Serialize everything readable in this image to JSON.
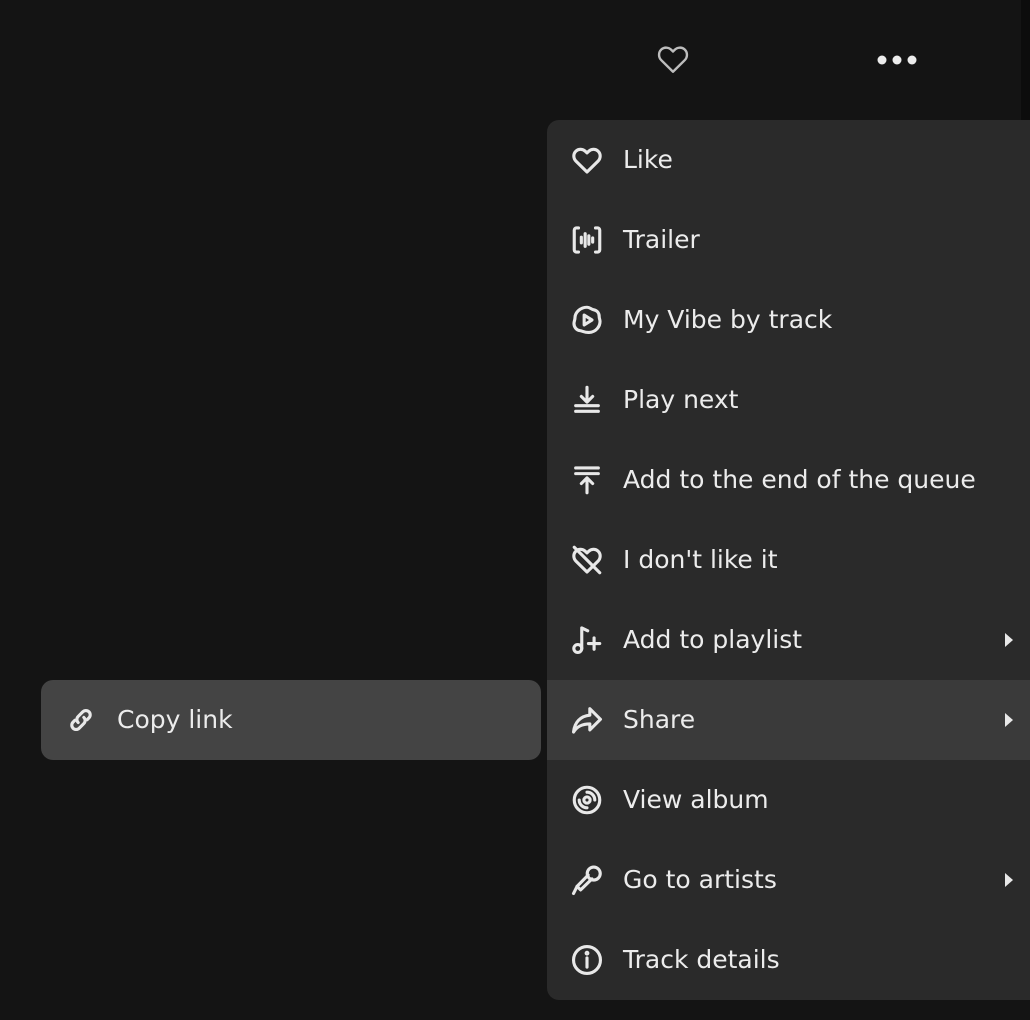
{
  "header": {
    "like_icon": "heart-icon",
    "more_icon": "more-dots-icon"
  },
  "menu": {
    "items": [
      {
        "label": "Like",
        "icon": "heart-icon"
      },
      {
        "label": "Trailer",
        "icon": "waveform-icon"
      },
      {
        "label": "My Vibe by track",
        "icon": "my-vibe-icon"
      },
      {
        "label": "Play next",
        "icon": "play-next-icon"
      },
      {
        "label": "Add to the end of the queue",
        "icon": "add-to-queue-end-icon"
      },
      {
        "label": "I don't like it",
        "icon": "broken-heart-icon"
      },
      {
        "label": "Add to playlist",
        "icon": "music-note-plus-icon",
        "submenu": true
      },
      {
        "label": "Share",
        "icon": "share-arrow-icon",
        "submenu": true,
        "active": true
      },
      {
        "label": "View album",
        "icon": "album-disc-icon"
      },
      {
        "label": "Go to artists",
        "icon": "microphone-icon",
        "submenu": true
      },
      {
        "label": "Track details",
        "icon": "info-icon"
      }
    ]
  },
  "share_submenu": {
    "items": [
      {
        "label": "Copy link",
        "icon": "link-icon"
      }
    ]
  },
  "colors": {
    "background": "#141414",
    "menu": "#2a2a2a",
    "menu_active": "#3a3a3a",
    "submenu": "#444444",
    "text": "#ececec"
  }
}
